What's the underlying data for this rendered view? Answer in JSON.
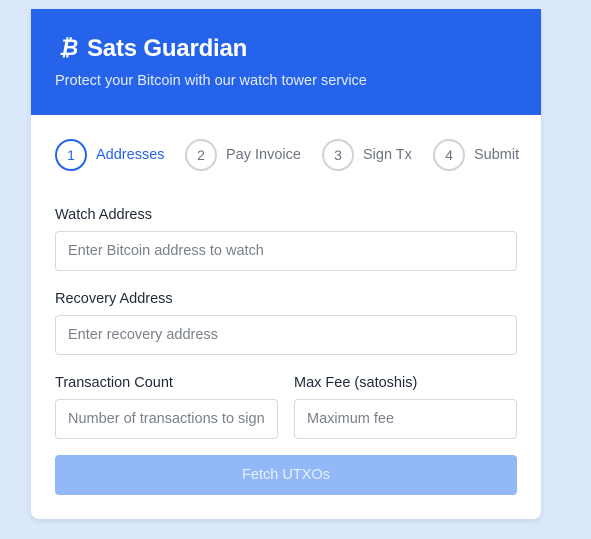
{
  "header": {
    "logo_icon": "bitcoin-icon",
    "logo_glyph": "₿",
    "title": "Sats Guardian",
    "subtitle": "Protect your Bitcoin with our watch tower service"
  },
  "steps": [
    {
      "number": "1",
      "label": "Addresses",
      "active": true
    },
    {
      "number": "2",
      "label": "Pay Invoice",
      "active": false
    },
    {
      "number": "3",
      "label": "Sign Tx",
      "active": false
    },
    {
      "number": "4",
      "label": "Submit",
      "active": false
    }
  ],
  "form": {
    "watch_address": {
      "label": "Watch Address",
      "placeholder": "Enter Bitcoin address to watch",
      "value": ""
    },
    "recovery_address": {
      "label": "Recovery Address",
      "placeholder": "Enter recovery address",
      "value": ""
    },
    "transaction_count": {
      "label": "Transaction Count",
      "placeholder": "Number of transactions to sign",
      "value": ""
    },
    "max_fee": {
      "label": "Max Fee (satoshis)",
      "placeholder": "Maximum fee",
      "value": ""
    }
  },
  "fetch_button": {
    "label": "Fetch UTXOs",
    "disabled": true
  },
  "colors": {
    "primary": "#2563eb",
    "page_background": "#dbe8fb",
    "button_disabled": "#93b8f8"
  }
}
